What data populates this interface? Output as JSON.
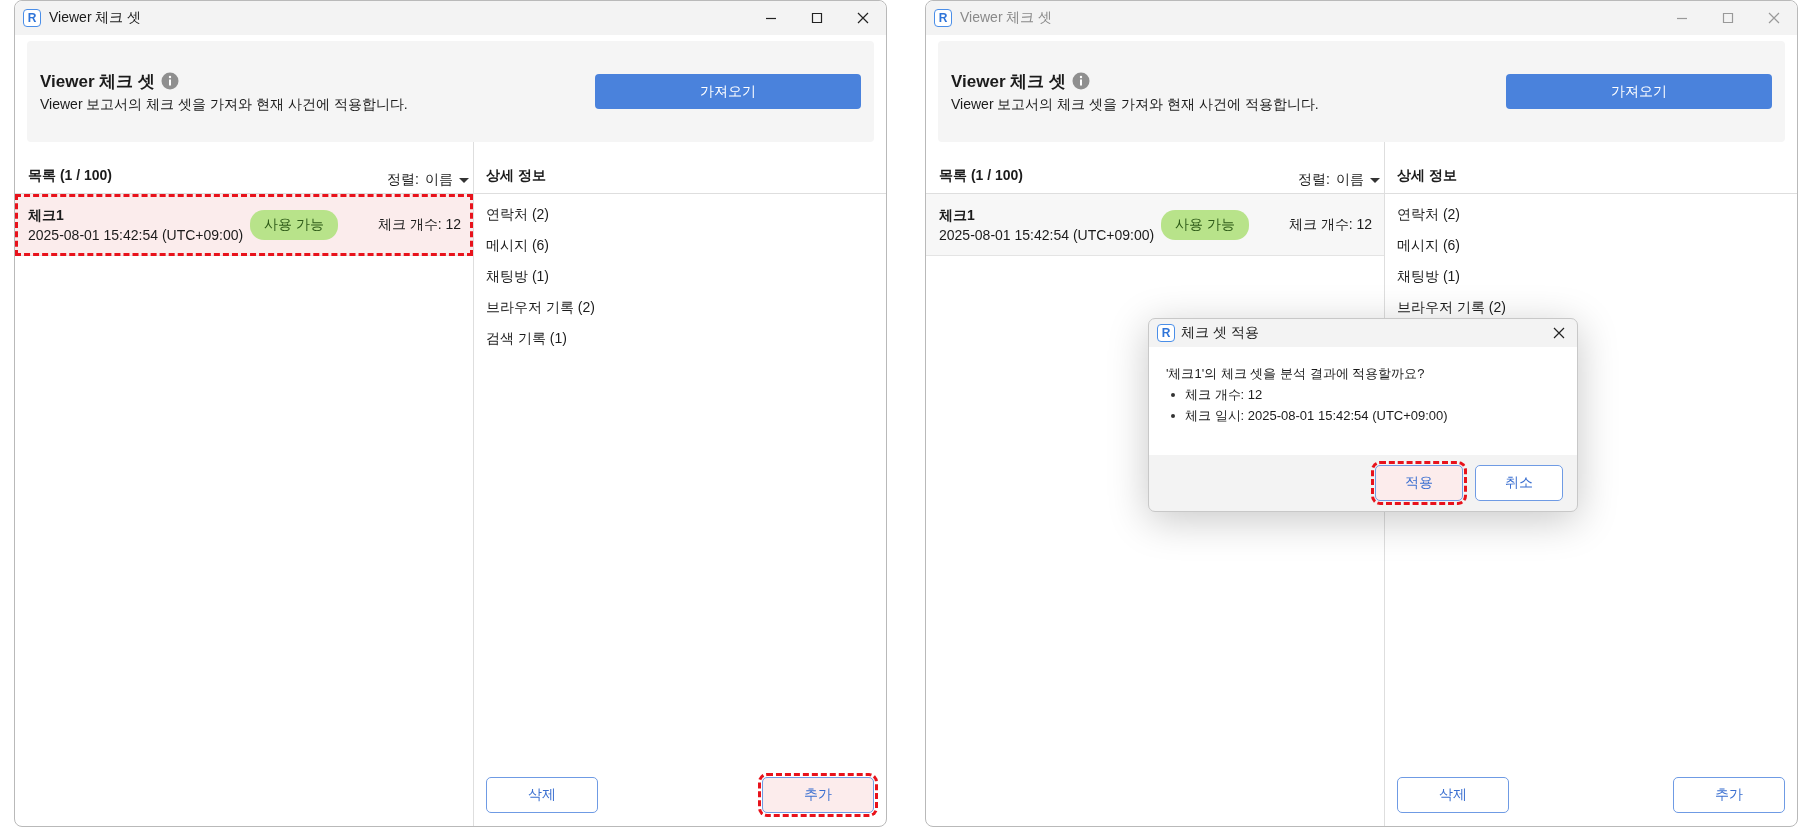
{
  "windows": [
    {
      "title": "Viewer 체크 셋",
      "app_icon": "R",
      "active": true,
      "header": {
        "title": "Viewer 체크 셋",
        "description": "Viewer 보고서의 체크 셋을 가져와 현재 사건에 적용합니다.",
        "import_button": "가져오기"
      },
      "list": {
        "title": "목록 (1 / 100)",
        "sort_label": "정렬:",
        "sort_value": "이름",
        "items": [
          {
            "name": "체크1",
            "date": "2025-08-01 15:42:54 (UTC+09:00)",
            "status": "사용 가능",
            "count": "체크 개수: 12",
            "highlighted": true
          }
        ]
      },
      "details": {
        "title": "상세 정보",
        "items": [
          "연락처 (2)",
          "메시지 (6)",
          "채팅방 (1)",
          "브라우저 기록 (2)",
          "검색 기록 (1)"
        ]
      },
      "buttons": [
        {
          "label": "삭제",
          "highlighted": false
        },
        {
          "label": "추가",
          "highlighted": true
        }
      ]
    },
    {
      "title": "Viewer 체크 셋",
      "app_icon": "R",
      "active": false,
      "header": {
        "title": "Viewer 체크 셋",
        "description": "Viewer 보고서의 체크 셋을 가져와 현재 사건에 적용합니다.",
        "import_button": "가져오기"
      },
      "list": {
        "title": "목록 (1 / 100)",
        "sort_label": "정렬:",
        "sort_value": "이름",
        "items": [
          {
            "name": "체크1",
            "date": "2025-08-01 15:42:54 (UTC+09:00)",
            "status": "사용 가능",
            "count": "체크 개수: 12",
            "highlighted": false
          }
        ]
      },
      "details": {
        "title": "상세 정보",
        "items": [
          "연락처 (2)",
          "메시지 (6)",
          "채팅방 (1)",
          "브라우저 기록 (2)"
        ]
      },
      "buttons": [
        {
          "label": "삭제",
          "highlighted": false
        },
        {
          "label": "추가",
          "highlighted": false
        }
      ],
      "dialog": {
        "title": "체크 셋 적용",
        "app_icon": "R",
        "message": "'체크1'의 체크 셋을 분석 결과에 적용할까요?",
        "bullets": [
          "체크 개수: 12",
          "체크 일시: 2025-08-01 15:42:54 (UTC+09:00)"
        ],
        "buttons": [
          {
            "label": "적용",
            "highlighted": true
          },
          {
            "label": "취소",
            "highlighted": false
          }
        ]
      }
    }
  ]
}
